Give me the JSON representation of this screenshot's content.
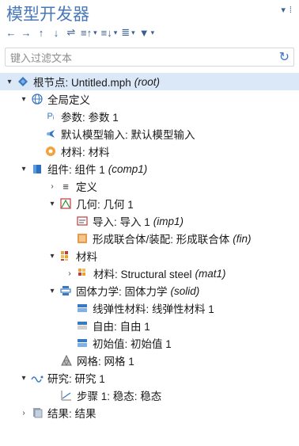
{
  "header": {
    "title": "模型开发器",
    "menu_glyph": "▾ ⁞"
  },
  "toolbar": {
    "left": "←",
    "right": "→",
    "up": "↑",
    "down": "↓",
    "b1": "⇌",
    "b2": "≡↑",
    "b3": "≡↓",
    "b4": "≣",
    "b5": "▼"
  },
  "filter": {
    "placeholder": "键入过滤文本",
    "refresh": "↻"
  },
  "tree": {
    "root": "根节点: Untitled.mph",
    "root_tag": "(root)",
    "global": "全局定义",
    "params": "参数: 参数 1",
    "default_input": "默认模型输入: 默认模型输入",
    "materials_global": "材料: 材料",
    "component": "组件: 组件 1",
    "component_tag": "(comp1)",
    "definitions": "定义",
    "geometry": "几何: 几何 1",
    "import": "导入: 导入 1",
    "import_tag": "(imp1)",
    "union": "形成联合体/装配: 形成联合体",
    "union_tag": "(fin)",
    "materials": "材料",
    "material_steel": "材料: Structural steel",
    "material_tag": "(mat1)",
    "solid": "固体力学: 固体力学",
    "solid_tag": "(solid)",
    "linear_elastic": "线弹性材料: 线弹性材料 1",
    "free": "自由: 自由 1",
    "initial": "初始值: 初始值 1",
    "mesh": "网格: 网格 1",
    "study": "研究: 研究 1",
    "step": "步骤 1: 稳态: 稳态",
    "results": "结果: 结果"
  }
}
